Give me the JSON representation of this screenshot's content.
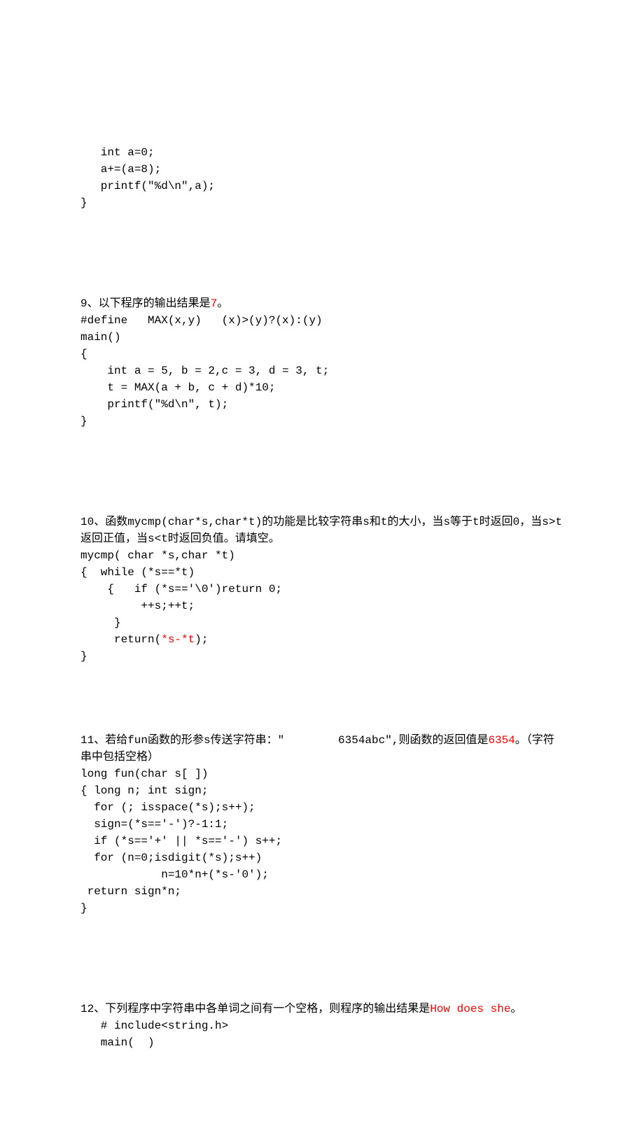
{
  "q8": {
    "code": "   int a=0;\n   a+=(a=8);\n   printf(″%d\\n″,a);\n}"
  },
  "q9": {
    "intro_pre": "9、以下程序的输出结果是",
    "answer": "7",
    "intro_post": "。",
    "code": "#define   MAX(x,y)   (x)>(y)?(x):(y)\nmain()\n{\n    int a = 5, b = 2,c = 3, d = 3, t;\n    t = MAX(a + b, c + d)*10;\n    printf(″%d\\n″, t);\n}"
  },
  "q10": {
    "intro": "10、函数mycmp(char*s,char*t)的功能是比较字符串s和t的大小，当s等于t时返回0，当s>t返回正值，当s<t时返回负值。请填空。",
    "code_pre": "mycmp( char *s,char *t)\n{  while (*s==*t)\n    {   if (*s=='\\0')return 0;\n         ++s;++t;\n     }\n     return(",
    "answer": "*s-*t",
    "code_post": ");\n}"
  },
  "q11": {
    "intro_pre": "11、若给fun函数的形参s传送字符串：″        6354abc″,则函数的返回值是",
    "answer": "6354",
    "intro_post": "。（字符串中包括空格）",
    "code": "long fun(char s[ ])\n{ long n; int sign;\n  for (; isspace(*s);s++);\n  sign=(*s=='-')?-1:1;\n  if (*s=='+' || *s=='-') s++;\n  for (n=0;isdigit(*s);s++)\n            n=10*n+(*s-'0');\n return sign*n;\n}"
  },
  "q12": {
    "intro_pre": "12、下列程序中字符串中各单词之间有一个空格，则程序的输出结果是",
    "answer": "How does she",
    "intro_post": "。",
    "code": "   # include<string.h>\n   main(  )"
  }
}
